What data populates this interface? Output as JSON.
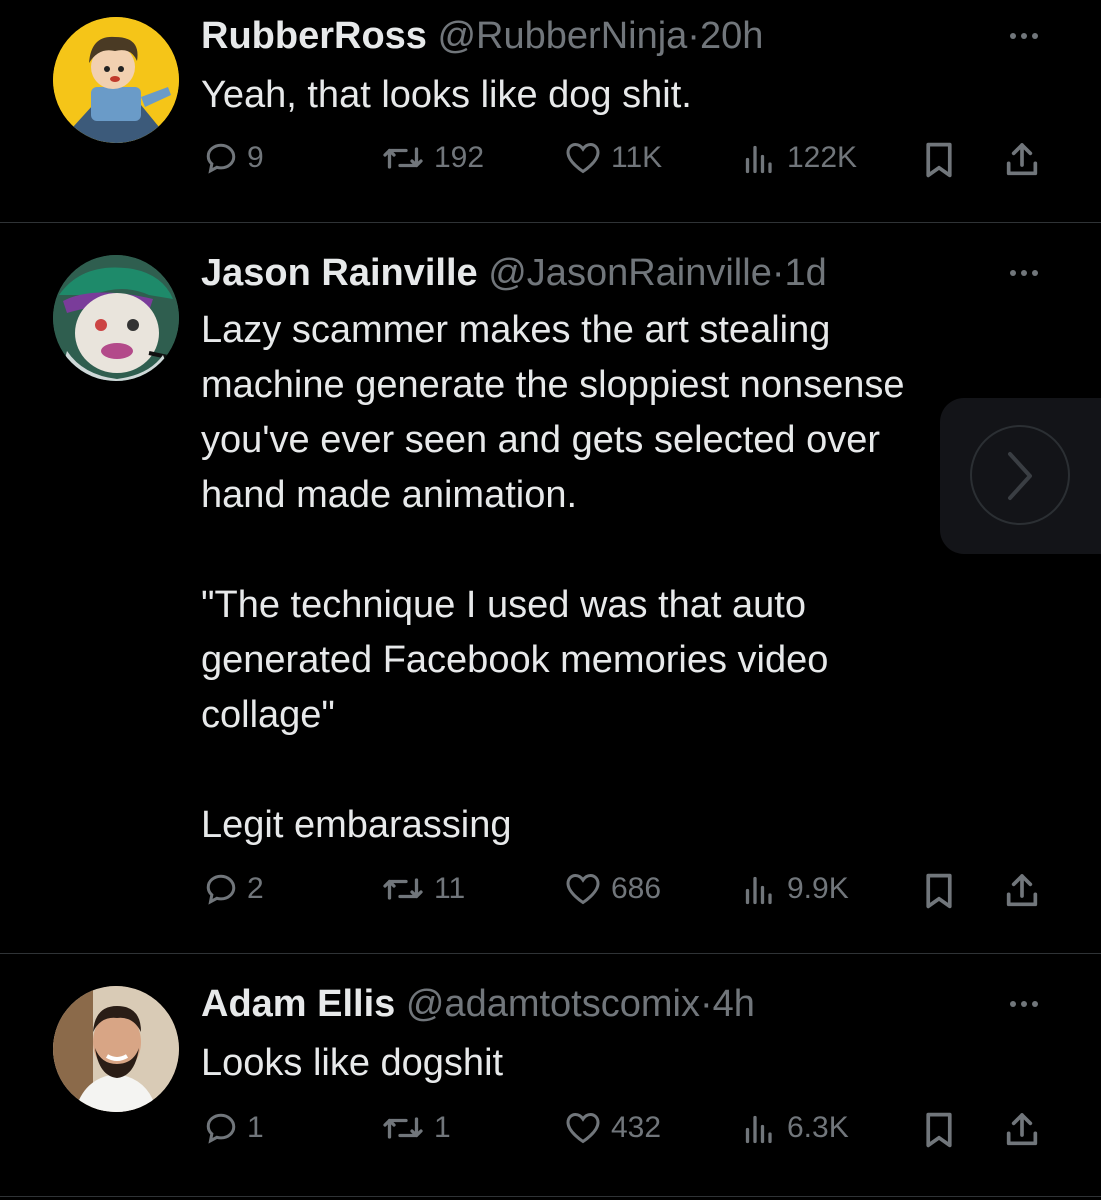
{
  "tweets": [
    {
      "name": "RubberRoss",
      "handle": "@RubberNinja",
      "time": "20h",
      "text": "Yeah, that looks like dog shit.",
      "replies": "9",
      "reposts": "192",
      "likes": "11K",
      "views": "122K"
    },
    {
      "name": "Jason Rainville",
      "handle": "@JasonRainville",
      "time": "1d",
      "text": "Lazy scammer makes the art stealing\nmachine generate the sloppiest nonsense\nyou've ever seen and gets selected over\nhand made animation.\n\n\"The technique I used was that auto\ngenerated Facebook memories video\ncollage\"\n\nLegit embarassing",
      "replies": "2",
      "reposts": "11",
      "likes": "686",
      "views": "9.9K"
    },
    {
      "name": "Adam Ellis",
      "handle": "@adamtotscomix",
      "time": "4h",
      "text": "Looks like dogshit",
      "replies": "1",
      "reposts": "1",
      "likes": "432",
      "views": "6.3K"
    }
  ],
  "separator": "·",
  "colors": {
    "background": "#000000",
    "text": "#e7e9ea",
    "muted": "#71767b",
    "divider": "#2f3336"
  },
  "icons": [
    "reply-icon",
    "repost-icon",
    "like-icon",
    "views-icon",
    "bookmark-icon",
    "share-icon",
    "more-icon",
    "chevron-right-icon"
  ]
}
